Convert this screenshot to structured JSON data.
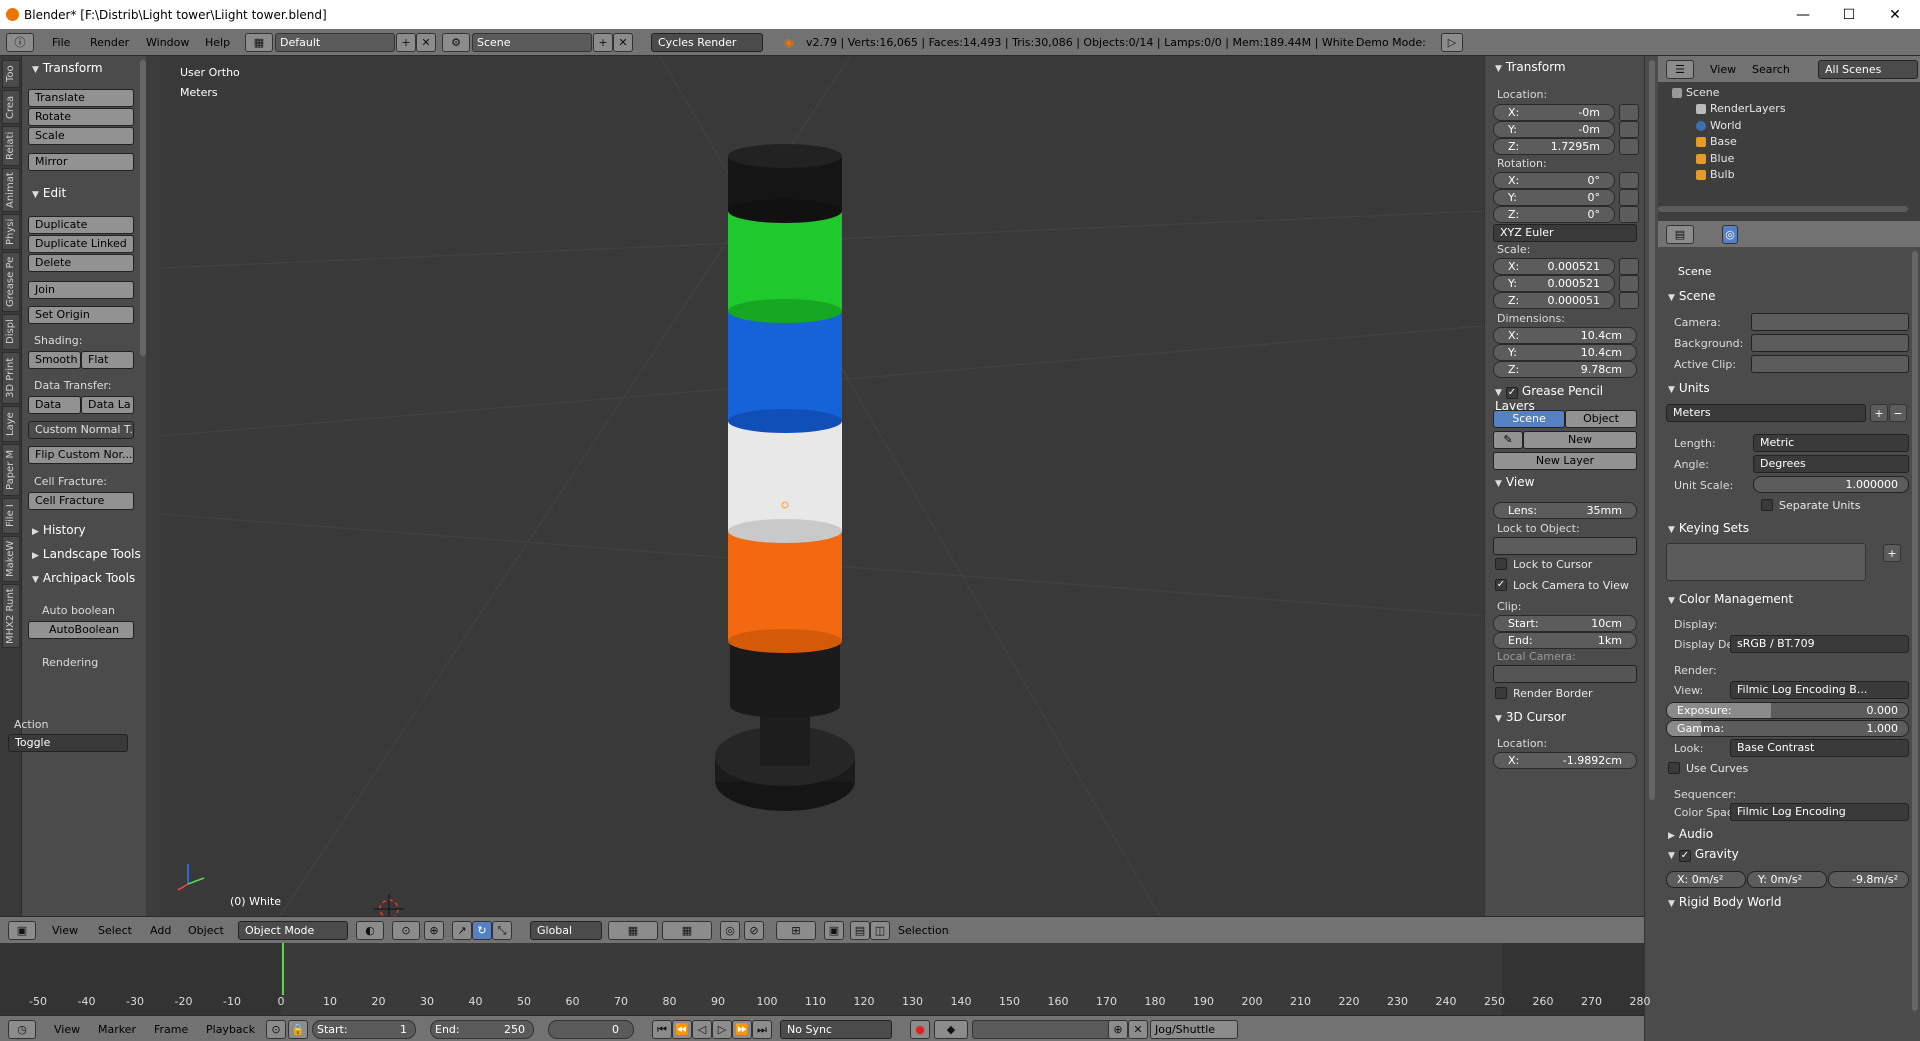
{
  "window": {
    "title": "Blender* [F:\\Distrib\\Light tower\\Liight tower.blend]",
    "minimize": "—",
    "maximize": "☐",
    "close": "✕"
  },
  "infobar": {
    "menus": [
      "File",
      "Render",
      "Window",
      "Help"
    ],
    "layout": "Default",
    "scene": "Scene",
    "engine": "Cycles Render",
    "stats": "v2.79 | Verts:16,065 | Faces:14,493 | Tris:30,086 | Objects:0/14 | Lamps:0/0 | Mem:189.44M | White",
    "demo_mode": "Demo Mode:"
  },
  "left_tabs": [
    "Too",
    "Crea",
    "Relati",
    "Animat",
    "Physi",
    "Grease Pe",
    "Displ",
    "3D Print",
    "Laye",
    "Paper M",
    "File I",
    "MakeW",
    "MHX2 Runt"
  ],
  "toolshelf": {
    "transform_header": "Transform",
    "translate": "Translate",
    "rotate": "Rotate",
    "scale": "Scale",
    "mirror": "Mirror",
    "edit_header": "Edit",
    "duplicate": "Duplicate",
    "duplicate_linked": "Duplicate Linked",
    "delete": "Delete",
    "join": "Join",
    "set_origin": "Set Origin",
    "shading_label": "Shading:",
    "smooth": "Smooth",
    "flat": "Flat",
    "data_transfer_label": "Data Transfer:",
    "data": "Data",
    "data_la": "Data La",
    "custom_normal": "Custom Normal T...",
    "flip_custom": "Flip Custom Nor...",
    "cell_fracture_label": "Cell Fracture:",
    "cell_fracture": "Cell Fracture",
    "history": "History",
    "landscape": "Landscape Tools",
    "archipack": "Archipack Tools",
    "auto_boolean_label": "Auto boolean",
    "autoboolean": "AutoBoolean",
    "rendering": "Rendering",
    "action_label": "Action",
    "action_value": "Toggle"
  },
  "viewport": {
    "view_name": "User Ortho",
    "units": "Meters",
    "object_label": "(0) White"
  },
  "npanel": {
    "transform": "Transform",
    "location": "Location:",
    "loc": [
      [
        "X:",
        "-0m"
      ],
      [
        "Y:",
        "-0m"
      ],
      [
        "Z:",
        "1.7295m"
      ]
    ],
    "rotation": "Rotation:",
    "rot": [
      [
        "X:",
        "0°"
      ],
      [
        "Y:",
        "0°"
      ],
      [
        "Z:",
        "0°"
      ]
    ],
    "rot_mode": "XYZ Euler",
    "scale": "Scale:",
    "scl": [
      [
        "X:",
        "0.000521"
      ],
      [
        "Y:",
        "0.000521"
      ],
      [
        "Z:",
        "0.000051"
      ]
    ],
    "dimensions": "Dimensions:",
    "dim": [
      [
        "X:",
        "10.4cm"
      ],
      [
        "Y:",
        "10.4cm"
      ],
      [
        "Z:",
        "9.78cm"
      ]
    ],
    "gp_layers": "Grease Pencil Layers",
    "gp_scene": "Scene",
    "gp_object": "Object",
    "gp_new": "New",
    "gp_new_layer": "New Layer",
    "view": "View",
    "lens_label": "Lens:",
    "lens_value": "35mm",
    "lock_to_object": "Lock to Object:",
    "lock_to_cursor": "Lock to Cursor",
    "lock_camera_view": "Lock Camera to View",
    "clip": "Clip:",
    "clip_start": [
      "Start:",
      "10cm"
    ],
    "clip_end": [
      "End:",
      "1km"
    ],
    "local_camera": "Local Camera:",
    "render_border": "Render Border",
    "cursor": "3D Cursor",
    "cursor_location": "Location:",
    "cursor_x": [
      "X:",
      "-1.9892cm"
    ]
  },
  "outliner": {
    "menus": [
      "View",
      "Search"
    ],
    "display": "All Scenes",
    "rows": [
      "Scene",
      "RenderLayers",
      "World",
      "Base",
      "Blue",
      "Bulb"
    ]
  },
  "properties": {
    "context": "Scene",
    "scene_header": "Scene",
    "camera": "Camera:",
    "background": "Background:",
    "active_clip": "Active Clip:",
    "units_header": "Units",
    "units_preset": "Meters",
    "length": "Length:",
    "length_value": "Metric",
    "angle": "Angle:",
    "angle_value": "Degrees",
    "unit_scale": "Unit Scale:",
    "unit_scale_value": "1.000000",
    "separate_units": "Separate Units",
    "keying_header": "Keying Sets",
    "color_header": "Color Management",
    "display": "Display:",
    "display_device_label": "Display De",
    "display_device": "sRGB / BT.709",
    "render": "Render:",
    "view_label": "View:",
    "view_value": "Filmic Log Encoding B...",
    "exposure": "Exposure:",
    "exposure_value": "0.000",
    "exposure_level": 0.43,
    "gamma": "Gamma:",
    "gamma_value": "1.000",
    "gamma_level": 0.14,
    "look": "Look:",
    "look_value": "Base Contrast",
    "use_curves": "Use Curves",
    "sequencer": "Sequencer:",
    "color_space_label": "Color Space:",
    "color_space": "Filmic Log Encoding",
    "audio": "Audio",
    "gravity": "Gravity",
    "gx": "X: 0m/s²",
    "gy": "Y: 0m/s²",
    "gz": "-9.8m/s²",
    "rigid": "Rigid Body World"
  },
  "view3d_header": {
    "menus": [
      "View",
      "Select",
      "Add",
      "Object"
    ],
    "mode": "Object Mode",
    "orientation": "Global",
    "selection": "Selection"
  },
  "timeline": {
    "ticks": [
      "-50",
      "-40",
      "-30",
      "-20",
      "-10",
      "0",
      "10",
      "20",
      "30",
      "40",
      "50",
      "60",
      "70",
      "80",
      "90",
      "100",
      "110",
      "120",
      "130",
      "140",
      "150",
      "160",
      "170",
      "180",
      "190",
      "200",
      "210",
      "220",
      "230",
      "240",
      "250",
      "260",
      "270",
      "280"
    ],
    "menus": [
      "View",
      "Marker",
      "Frame",
      "Playback"
    ],
    "start_label": "Start:",
    "start": "1",
    "end_label": "End:",
    "end": "250",
    "current": "0",
    "sync": "No Sync",
    "jog": "Jog/Shuttle"
  },
  "colors": {
    "green": "#1fc92d",
    "blue": "#1662d9",
    "white": "#e8e8e8",
    "orange": "#f2690f",
    "accent": "#5680c2"
  }
}
